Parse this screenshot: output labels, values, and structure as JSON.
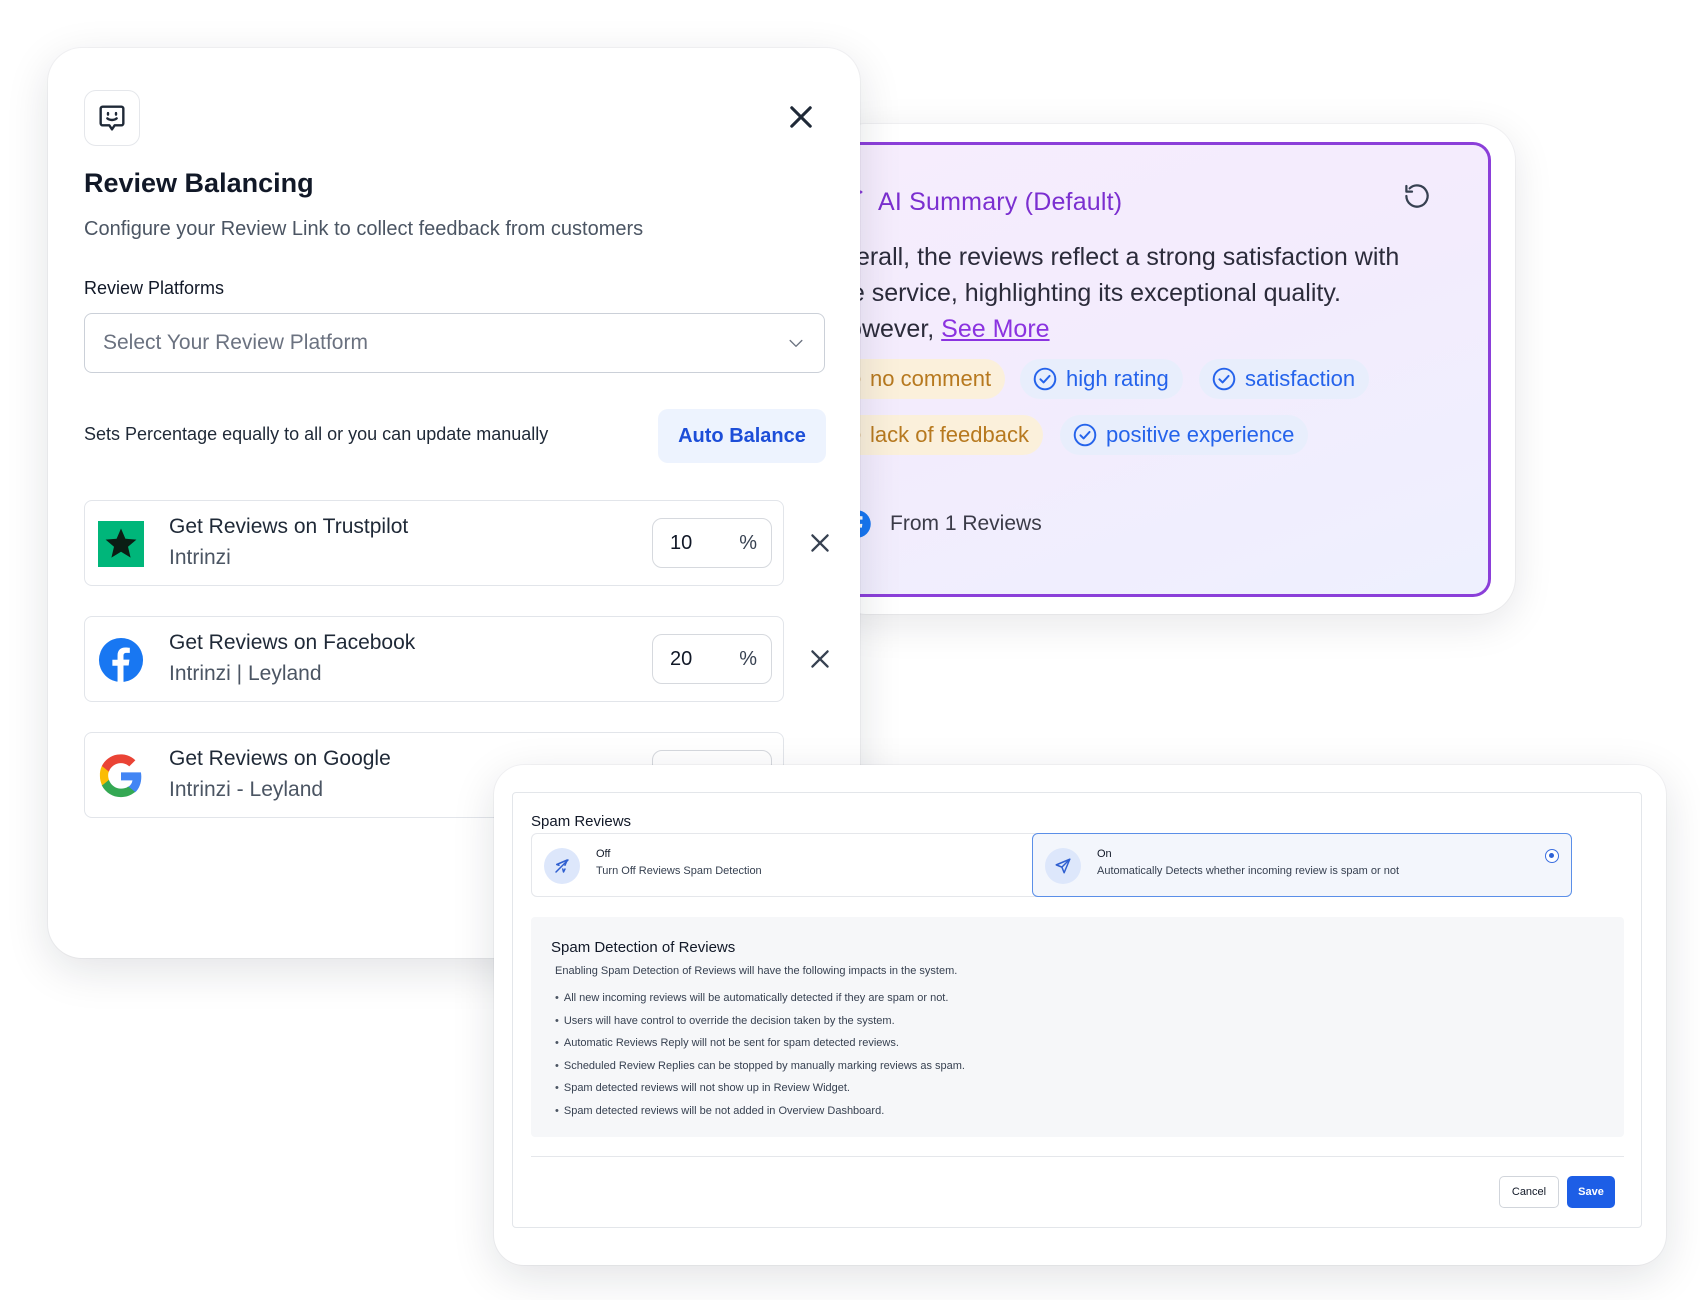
{
  "ai_summary": {
    "title": "AI Summary (Default)",
    "text_before": "Overall, the reviews reflect a strong satisfaction with the service, highlighting its exceptional quality. However, ",
    "see_more": "See More",
    "chips": [
      {
        "label": "no comment",
        "sentiment": "neutral"
      },
      {
        "label": "high rating",
        "sentiment": "positive"
      },
      {
        "label": "satisfaction",
        "sentiment": "positive"
      },
      {
        "label": "lack of feedback",
        "sentiment": "neutral"
      },
      {
        "label": "positive experience",
        "sentiment": "positive"
      }
    ],
    "footer": "From 1 Reviews",
    "icons": [
      "sparkle-icon",
      "refresh-icon",
      "google-logo",
      "facebook-logo"
    ]
  },
  "review_balancing": {
    "title": "Review Balancing",
    "subtitle": "Configure your Review Link to collect feedback from customers",
    "platforms_label": "Review Platforms",
    "select_placeholder": "Select Your Review Platform",
    "hint": "Sets Percentage equally to all or you can update manually",
    "auto_balance": "Auto Balance",
    "platforms": [
      {
        "name": "Get Reviews on Trustpilot",
        "location": "Intrinzi",
        "percent": "10",
        "unit": "%"
      },
      {
        "name": "Get Reviews on Facebook",
        "location": "Intrinzi | Leyland",
        "percent": "20",
        "unit": "%"
      },
      {
        "name": "Get Reviews on Google",
        "location": "Intrinzi - Leyland"
      }
    ]
  },
  "spam": {
    "title": "Spam Reviews",
    "options": [
      {
        "label": "Off",
        "desc": "Turn Off Reviews Spam Detection",
        "selected": false
      },
      {
        "label": "On",
        "desc": "Automatically Detects whether incoming review is spam or not",
        "selected": true
      }
    ],
    "detection": {
      "title": "Spam Detection of Reviews",
      "intro": "Enabling Spam Detection of Reviews will have the following impacts in the system.",
      "items": [
        "All new incoming reviews will be automatically detected if they are spam or not.",
        "Users will have control to override the decision taken by the system.",
        "Automatic Reviews Reply will not be sent for spam detected reviews.",
        "Scheduled Review Replies can be stopped by manually marking reviews as spam.",
        "Spam detected reviews will not show up in Review Widget.",
        "Spam detected reviews will be not added in Overview Dashboard."
      ]
    },
    "cancel": "Cancel",
    "save": "Save"
  },
  "colors": {
    "accent_blue": "#1d5ee6",
    "ai_purple": "#7b2fd0",
    "neutral_chip": "#b7791f",
    "positive_chip": "#2563eb",
    "trustpilot": "#00b67a",
    "facebook": "#1877f2"
  }
}
